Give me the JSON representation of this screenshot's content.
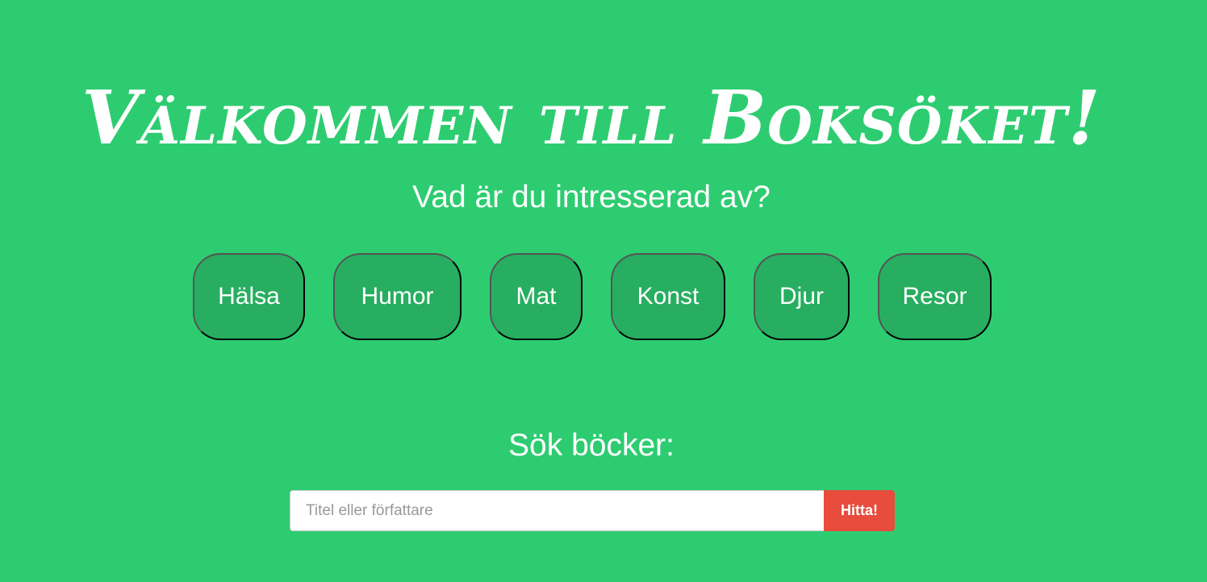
{
  "header": {
    "title": "Välkommen till Boksöket!"
  },
  "interests": {
    "heading": "Vad är du intresserad av?",
    "categories": [
      {
        "label": "Hälsa"
      },
      {
        "label": "Humor"
      },
      {
        "label": "Mat"
      },
      {
        "label": "Konst"
      },
      {
        "label": "Djur"
      },
      {
        "label": "Resor"
      }
    ]
  },
  "search": {
    "heading": "Sök böcker:",
    "placeholder": "Titel eller författare",
    "value": "",
    "button_label": "Hitta!"
  },
  "colors": {
    "background": "#2ecc71",
    "category_button": "#27ae60",
    "search_button": "#e74c3c",
    "text": "#ffffff"
  }
}
